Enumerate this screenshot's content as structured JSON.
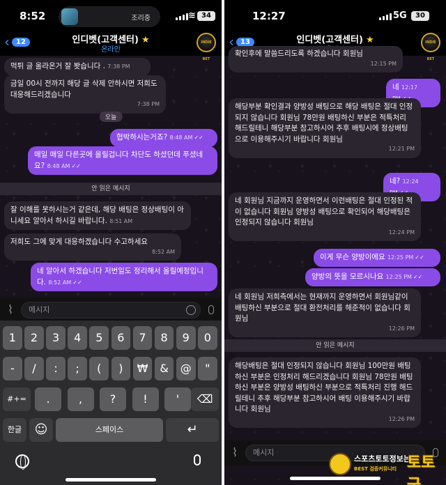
{
  "left": {
    "status": {
      "time": "8:52",
      "island_label": "조리중",
      "battery": "34"
    },
    "header": {
      "back_count": "12",
      "title": "인디벳(고객센터)",
      "subtitle": "온라인",
      "avatar": "INDIE BET"
    },
    "date_pill": "오늘",
    "unread_label": "안 읽은 메시지",
    "messages": [
      {
        "dir": "in",
        "text": "먹튀 글 올라온거 잘 봣습니다 .",
        "time": "7:38 PM"
      },
      {
        "dir": "in",
        "text": "금일 00시 전까지 해당 글 삭제 안하시면 저희도 대응해드리겠습니다",
        "time": "7:38 PM"
      },
      {
        "dir": "out",
        "text": "협박하시는거죠?",
        "time": "8:48 AM"
      },
      {
        "dir": "out",
        "text": "매일 매일 다른곳에 올릴겁니다 차단도 하셨던데 푸셨네요?",
        "time": "8:48 AM"
      },
      {
        "dir": "in",
        "text": "잘 이해를 못하시는거 같은데, 해당 배팅은 정상배팅이 아니세요 알아서 하시길 바랍니다.",
        "time": "8:51 AM"
      },
      {
        "dir": "in",
        "text": "저희도 그에 맞게 대응하겠습니다 수고하세요",
        "time": "8:52 AM"
      },
      {
        "dir": "out",
        "text": "네 알아서 하겠습니다 저번일도 정리해서 올릴예정입니다.",
        "time": "8:52 AM"
      }
    ],
    "input_placeholder": "메시지",
    "keyboard": {
      "row1": [
        "1",
        "2",
        "3",
        "4",
        "5",
        "6",
        "7",
        "8",
        "9",
        "0"
      ],
      "row2": [
        "-",
        "/",
        ":",
        ";",
        "(",
        ")",
        "₩",
        "&",
        "@",
        "\""
      ],
      "row3": [
        ".",
        ",",
        "?",
        "!",
        "'"
      ],
      "mode_key": "#+=",
      "lang_key": "한글",
      "space_key": "스페이스",
      "emoji_key": "☺",
      "return_key": "↵",
      "delete_key": "⌫"
    }
  },
  "right": {
    "status": {
      "time": "12:27",
      "network": "5G",
      "battery": "30"
    },
    "header": {
      "back_count": "13",
      "title": "인디벳(고객센터)",
      "subtitle": "온라인",
      "avatar": "INDIE BET"
    },
    "unread_label": "안 읽은 메시지",
    "messages": [
      {
        "dir": "in",
        "text": "확인후에 말씀드리도록 하겠습니다 회원님",
        "time": "12:15 PM"
      },
      {
        "dir": "out",
        "text": "네",
        "time": "12:17 PM"
      },
      {
        "dir": "in",
        "text": "해당부분 확인결과 양방성 배팅으로 해당 배팅은 절대 인정되지 않습니다 회원님 78만원 배팅하신 부분은 적특처리 해드릴테니 해당부분 참고하시어 추후 배팅시에 정상배팅으로 이용해주시기 바랍니다 회원님",
        "time": "12:21 PM"
      },
      {
        "dir": "out",
        "text": "네?",
        "time": "12:24 PM"
      },
      {
        "dir": "in",
        "text": "네 회원님 지금까지 운영하면서 이런배팅은 절대 인정된 적이 없습니다 회원님 양방성 배팅으로 확인되어 해당배팅은 인정되지 않습니다 회원님",
        "time": "12:24 PM"
      },
      {
        "dir": "out",
        "text": "이게 무슨 양방이에요",
        "time": "12:25 PM"
      },
      {
        "dir": "out",
        "text": "양방의 뜻을 모르시나요",
        "time": "12:25 PM"
      },
      {
        "dir": "in",
        "text": "네 회원님 저희측에서는 현재까지 운영하면서 회원님같이 배팅하신 부분으로 절대 환전처리를 해준적이 없습니다 회원님",
        "time": "12:26 PM"
      },
      {
        "dir": "in",
        "text": "해당배팅은 절대 인정되지 않습니다 회원님 100만원 배팅하신 부분은 인정처리 해드리겠습니다 회원님 78만원 배팅하신 부분은 양방성 배팅하신 부분으로 적특처리 진행 해드릴테니 추후 해당부분 참고하시어 배팅 이용해주시기 바랍니다 회원님",
        "time": "12:26 PM"
      }
    ],
    "input_placeholder": "메시지"
  },
  "watermark": {
    "line1": "스포츠토토정보는",
    "line2": "BEST 검증커뮤니티",
    "brand": "토토군"
  }
}
